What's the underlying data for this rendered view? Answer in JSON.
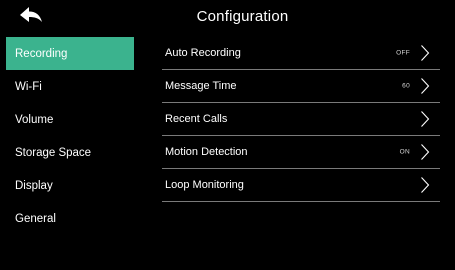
{
  "header": {
    "title": "Configuration",
    "back_icon": "back-arrow-icon"
  },
  "sidebar": {
    "active_color": "#3bb38e",
    "items": [
      {
        "label": "Recording",
        "active": true
      },
      {
        "label": "Wi-Fi",
        "active": false
      },
      {
        "label": "Volume",
        "active": false
      },
      {
        "label": "Storage Space",
        "active": false
      },
      {
        "label": "Display",
        "active": false
      },
      {
        "label": "General",
        "active": false
      }
    ]
  },
  "settings": {
    "rows": [
      {
        "label": "Auto Recording",
        "value": "OFF"
      },
      {
        "label": "Message Time",
        "value": "60"
      },
      {
        "label": "Recent Calls",
        "value": ""
      },
      {
        "label": "Motion Detection",
        "value": "ON"
      },
      {
        "label": "Loop Monitoring",
        "value": ""
      }
    ]
  }
}
